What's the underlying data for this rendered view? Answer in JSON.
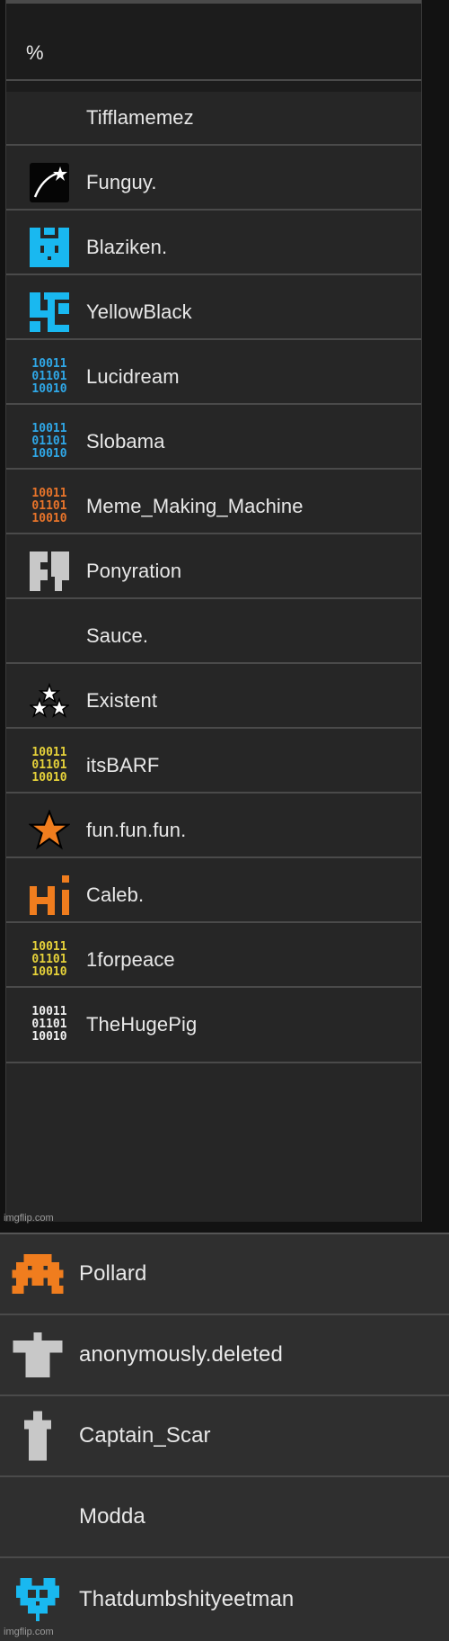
{
  "list_a": {
    "header": {
      "symbol": "%"
    },
    "items": [
      {
        "name": "Tifflamemez",
        "icon": "none"
      },
      {
        "name": "Funguy.",
        "icon": "shooting-star-icon"
      },
      {
        "name": "Blaziken.",
        "icon": "blue-pixel-cat-icon"
      },
      {
        "name": "YellowBlack",
        "icon": "blue-pixel-glyph-icon"
      },
      {
        "name": "Lucidream",
        "icon": "binary-blue-icon"
      },
      {
        "name": "Slobama",
        "icon": "binary-blue-icon"
      },
      {
        "name": "Meme_Making_Machine",
        "icon": "binary-orange-icon"
      },
      {
        "name": "Ponyration",
        "icon": "grey-pixel-icon"
      },
      {
        "name": "Sauce.",
        "icon": "none"
      },
      {
        "name": "Existent",
        "icon": "three-stars-icon"
      },
      {
        "name": "itsBARF",
        "icon": "binary-yellow-icon"
      },
      {
        "name": "fun.fun.fun.",
        "icon": "orange-star-icon"
      },
      {
        "name": "Caleb.",
        "icon": "orange-hi-icon"
      },
      {
        "name": "1forpeace",
        "icon": "binary-yellow-icon"
      },
      {
        "name": "TheHugePig",
        "icon": "binary-white-icon"
      }
    ],
    "watermark": "imgflip.com"
  },
  "list_b": {
    "items": [
      {
        "name": "Pollard",
        "icon": "orange-invader-icon"
      },
      {
        "name": "anonymously.deleted",
        "icon": "grey-shirt-icon"
      },
      {
        "name": "Captain_Scar",
        "icon": "grey-cross-icon"
      },
      {
        "name": "Modda",
        "icon": "none"
      },
      {
        "name": "Thatdumbshityeetman",
        "icon": "blue-pixel-heart-icon"
      }
    ],
    "watermark": "imgflip.com"
  },
  "colors": {
    "binary_blue": "#2fa8e8",
    "binary_orange": "#e8742a",
    "binary_yellow": "#e6d23a",
    "binary_white": "#f0f0f0",
    "pixel_blue": "#19b8f0",
    "orange": "#f07d1e",
    "grey": "#c8c8c8"
  },
  "binary_text": "10011\n01101\n10010"
}
